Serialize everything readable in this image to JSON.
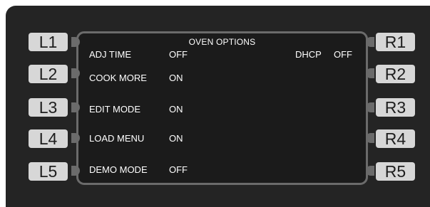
{
  "screen": {
    "title": "OVEN OPTIONS"
  },
  "options": [
    {
      "label": "ADJ TIME",
      "value": "OFF"
    },
    {
      "label": "COOK MORE",
      "value": "ON"
    },
    {
      "label": "EDIT MODE",
      "value": "ON"
    },
    {
      "label": "LOAD MENU",
      "value": "ON"
    },
    {
      "label": "DEMO MODE",
      "value": "OFF"
    }
  ],
  "dhcp": {
    "label": "DHCP",
    "value": "OFF"
  },
  "left_keys": [
    "L1",
    "L2",
    "L3",
    "L4",
    "L5"
  ],
  "right_keys": [
    "R1",
    "R2",
    "R3",
    "R4",
    "R5"
  ],
  "colors": {
    "panel": "#242424",
    "screen_border": "#6b6b6b",
    "key_face": "#d7d7d7",
    "text": "#ffffff"
  }
}
